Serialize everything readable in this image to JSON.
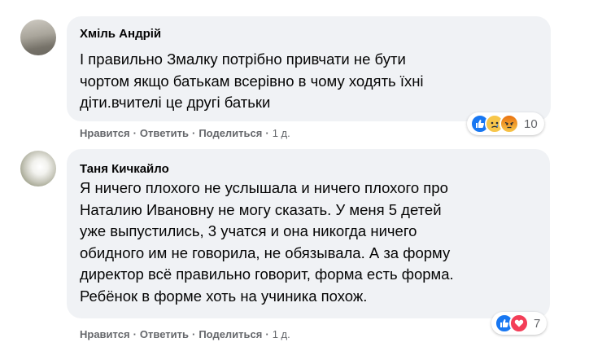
{
  "comments": [
    {
      "author": "Хміль Андрій",
      "text_lines": [
        "І правильно Змалку потрібно привчати не бути",
        "чортом якщо батькам всерівно в чому ходять їхні",
        "діти.вчителі це другі батьки"
      ],
      "actions": {
        "like": "Нравится",
        "reply": "Ответить",
        "share": "Поделиться",
        "time": "1 д."
      },
      "reactions": {
        "icons": [
          "like-icon",
          "sad-icon",
          "angry-icon"
        ],
        "count": "10"
      }
    },
    {
      "author": "Таня Кичкайло",
      "text_lines": [
        "Я ничего плохого не услышала и ничего плохого про",
        "Наталию Ивановну не могу сказать. У меня 5 детей",
        "уже выпустились, 3 учатся и она никогда ничего",
        "обидного им не говорила, не обязывала. А за форму",
        "директор всё правильно говорит, форма есть форма.",
        "Ребёнок в форме хоть на учиника похож."
      ],
      "actions": {
        "like": "Нравится",
        "reply": "Ответить",
        "share": "Поделиться",
        "time": "1 д."
      },
      "reactions": {
        "icons": [
          "like-icon",
          "love-icon"
        ],
        "count": "7"
      }
    }
  ],
  "colors": {
    "bubble": "#f0f2f5",
    "text": "#050505",
    "secondary": "#65676b",
    "like": "#1877f2",
    "love": "#f33e58",
    "sad": "#f7c64a"
  }
}
